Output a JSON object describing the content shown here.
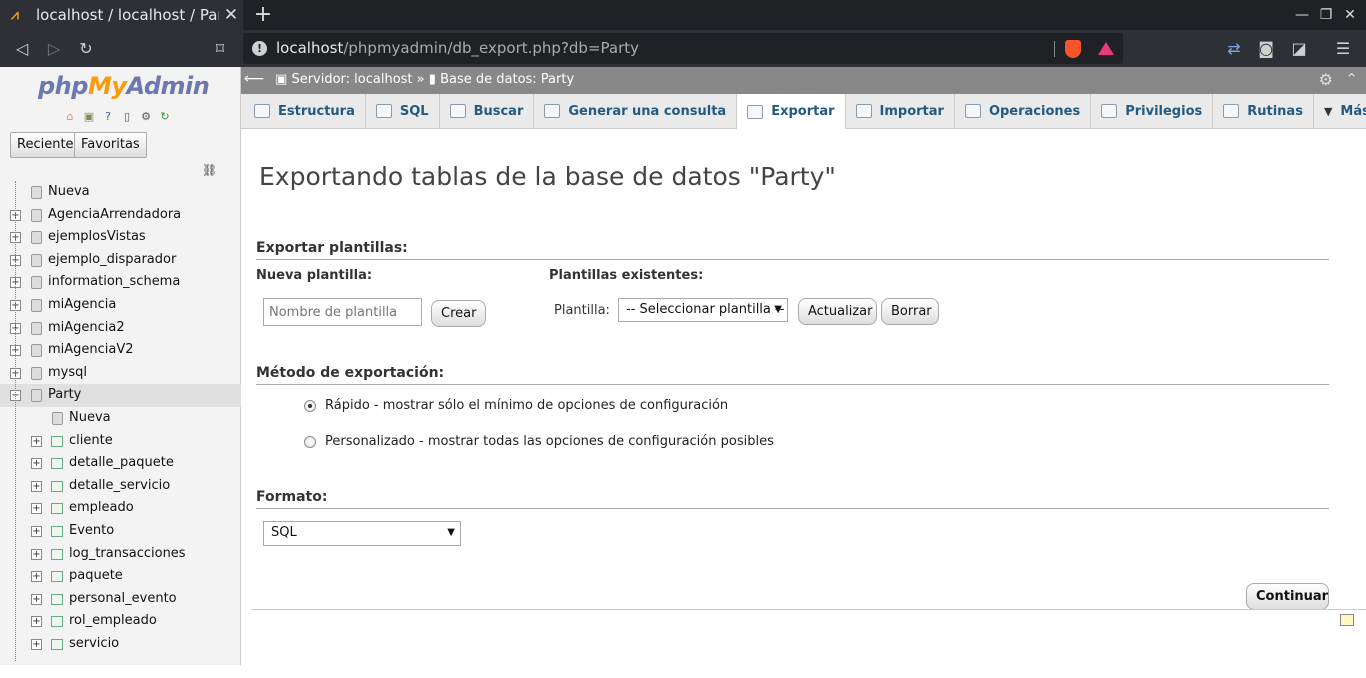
{
  "browser": {
    "tab_title": "localhost / localhost / Party",
    "url_host": "localhost",
    "url_path": "/phpmyadmin/db_export.php?db=Party"
  },
  "sidebar": {
    "logo": {
      "php": "php",
      "my": "My",
      "admin": "Admin"
    },
    "buttons": {
      "recent": "Reciente",
      "favorites": "Favoritas"
    },
    "new_label": "Nueva",
    "databases": [
      "AgenciaArrendadora",
      "ejemplosVistas",
      "ejemplo_disparador",
      "information_schema",
      "miAgencia",
      "miAgencia2",
      "miAgenciaV2",
      "mysql"
    ],
    "selected_db": "Party",
    "tables": [
      "cliente",
      "detalle_paquete",
      "detalle_servicio",
      "empleado",
      "Evento",
      "log_transacciones",
      "paquete",
      "personal_evento",
      "rol_empleado",
      "servicio"
    ]
  },
  "breadcrumb": {
    "server": "Servidor: localhost",
    "sep": "»",
    "db": "Base de datos: Party"
  },
  "menu": {
    "tabs": [
      "Estructura",
      "SQL",
      "Buscar",
      "Generar una consulta",
      "Exportar",
      "Importar",
      "Operaciones",
      "Privilegios",
      "Rutinas",
      "Más"
    ],
    "active": "Exportar"
  },
  "page": {
    "title": "Exportando tablas de la base de datos \"Party\"",
    "templates": {
      "legend": "Exportar plantillas:",
      "new_label": "Nueva plantilla:",
      "new_placeholder": "Nombre de plantilla",
      "create": "Crear",
      "existing_label": "Plantillas existentes:",
      "template_label": "Plantilla:",
      "select_value": "-- Seleccionar plantilla --",
      "update": "Actualizar",
      "delete": "Borrar"
    },
    "method": {
      "legend": "Método de exportación:",
      "quick": "Rápido - mostrar sólo el mínimo de opciones de configuración",
      "custom": "Personalizado - mostrar todas las opciones de configuración posibles",
      "selected": "quick"
    },
    "format": {
      "legend": "Formato:",
      "value": "SQL"
    },
    "continue": "Continuar"
  }
}
